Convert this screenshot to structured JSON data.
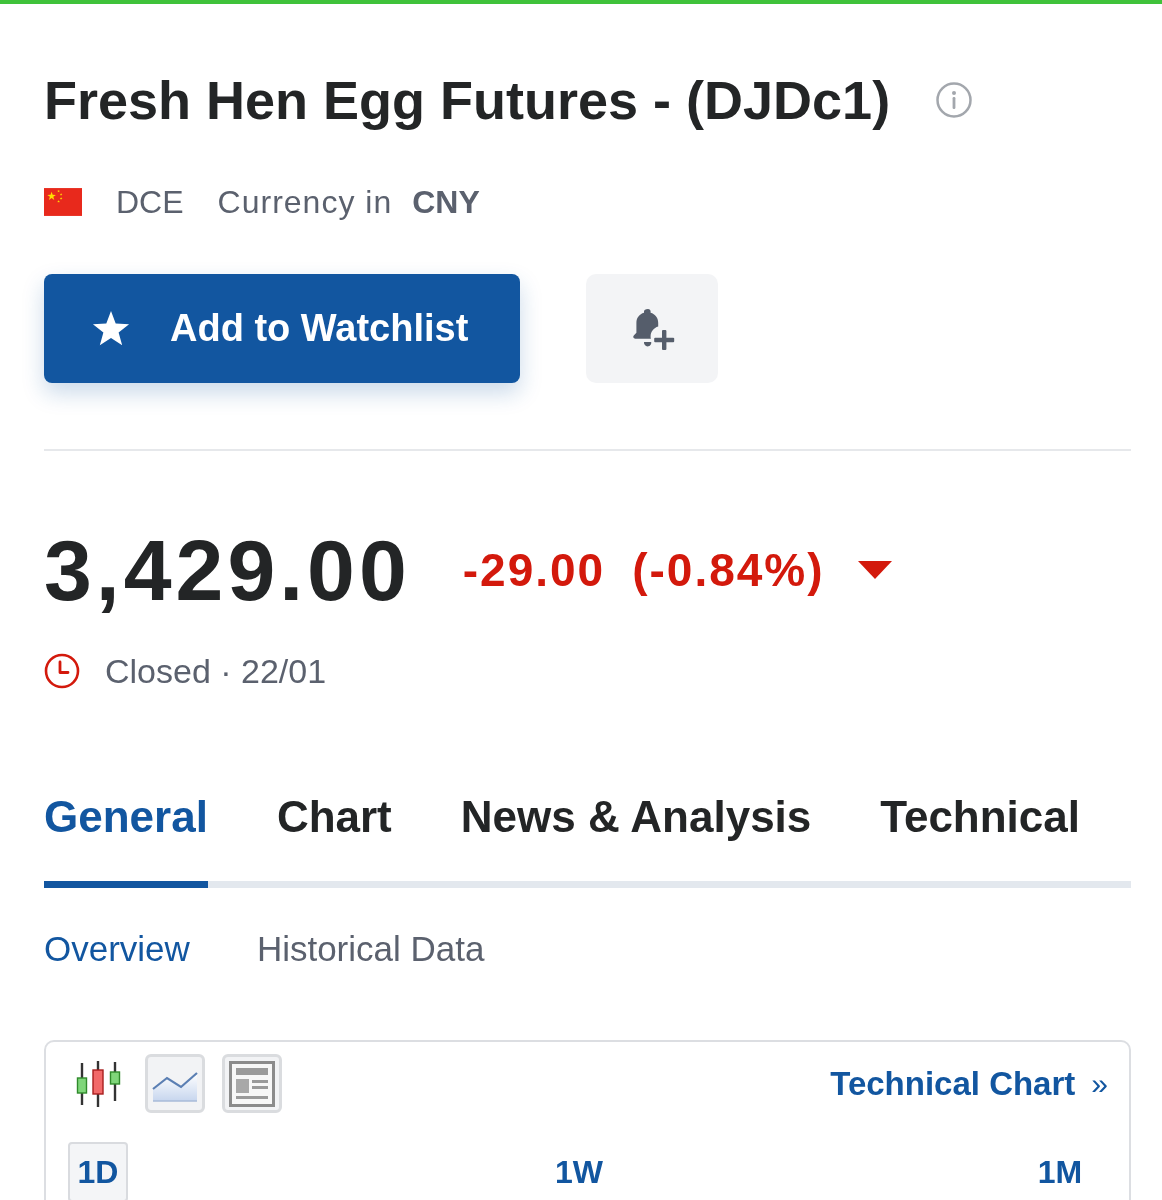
{
  "header": {
    "title": "Fresh Hen Egg Futures - (DJDc1)",
    "exchange": "DCE",
    "currency_label": "Currency in",
    "currency": "CNY"
  },
  "actions": {
    "watchlist_button": "Add to Watchlist"
  },
  "quote": {
    "price": "3,429.00",
    "change": "-29.00",
    "change_percent": "(-0.84%)",
    "negative": true,
    "status": "Closed · 22/01"
  },
  "tabs": [
    {
      "label": "General",
      "selected": true
    },
    {
      "label": "Chart",
      "selected": false
    },
    {
      "label": "News & Analysis",
      "selected": false
    },
    {
      "label": "Technical",
      "selected": false
    }
  ],
  "subtabs": [
    {
      "label": "Overview",
      "selected": true
    },
    {
      "label": "Historical Data",
      "selected": false
    }
  ],
  "chart_widget": {
    "tools": [
      {
        "kind": "candlestick"
      },
      {
        "kind": "line"
      },
      {
        "kind": "article"
      }
    ],
    "link": {
      "label": "Technical Chart",
      "arrow": "»"
    },
    "periods": [
      {
        "label": "1D",
        "selected": true
      },
      {
        "label": "1W",
        "selected": false
      },
      {
        "label": "1M",
        "selected": false
      }
    ]
  }
}
